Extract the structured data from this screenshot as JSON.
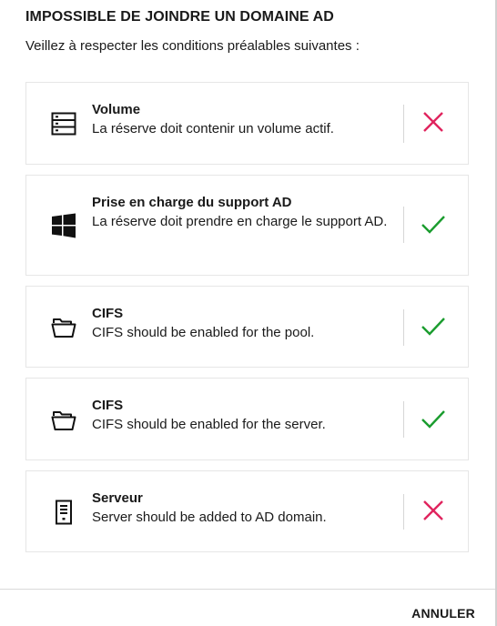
{
  "dialog": {
    "title": "IMPOSSIBLE DE JOINDRE UN DOMAINE AD",
    "subtitle": "Veillez à respecter les conditions préalables suivantes :",
    "cancel_label": "ANNULER"
  },
  "colors": {
    "fail": "#e0245e",
    "pass": "#1a9c2e"
  },
  "requirements": [
    {
      "icon": "volume-icon",
      "name": "Volume",
      "description": "La réserve doit contenir un volume actif.",
      "status": "fail"
    },
    {
      "icon": "windows-icon",
      "name": "Prise en charge du support AD",
      "description": "La réserve doit prendre en charge le support AD.",
      "status": "pass"
    },
    {
      "icon": "folder-open-icon",
      "name": "CIFS",
      "description": "CIFS should be enabled for the pool.",
      "status": "pass"
    },
    {
      "icon": "folder-open-icon",
      "name": "CIFS",
      "description": "CIFS should be enabled for the server.",
      "status": "pass"
    },
    {
      "icon": "server-icon",
      "name": "Serveur",
      "description": "Server should be added to AD domain.",
      "status": "fail"
    }
  ]
}
